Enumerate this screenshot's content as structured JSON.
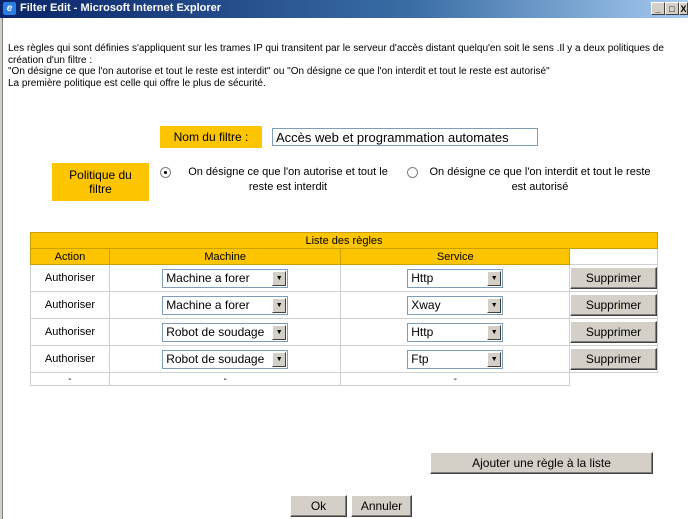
{
  "window": {
    "title": "Filter Edit - Microsoft Internet Explorer",
    "minimize_glyph": "_",
    "maximize_glyph": "□",
    "close_glyph": "X"
  },
  "intro": {
    "line1": "Les règles qui sont définies s'appliquent sur les trames IP qui transitent par le serveur d'accès distant quelqu'en soit le sens .Il y a deux politiques de création d'un filtre :",
    "line2": "\"On désigne ce que l'on autorise et tout le reste est interdit\" ou \"On désigne ce que l'on interdit et tout le reste est autorisé\"",
    "line3": "La première politique est celle qui offre le plus de sécurité."
  },
  "filter_name": {
    "label": "Nom du filtre :",
    "value": "Accès web et programmation automates"
  },
  "policy": {
    "label": "Politique du filtre",
    "option1": "On désigne ce que l'on autorise et tout le reste est interdit",
    "option2": "On désigne ce que l'on interdit et tout le reste est autorisé",
    "selected": 1
  },
  "rules": {
    "caption": "Liste des règles",
    "headers": {
      "action": "Action",
      "machine": "Machine",
      "service": "Service"
    },
    "rows": [
      {
        "action": "Authoriser",
        "machine": "Machine a forer",
        "service": "Http",
        "delete_label": "Supprimer"
      },
      {
        "action": "Authoriser",
        "machine": "Machine a forer",
        "service": "Xway",
        "delete_label": "Supprimer"
      },
      {
        "action": "Authoriser",
        "machine": "Robot de soudage",
        "service": "Http",
        "delete_label": "Supprimer"
      },
      {
        "action": "Authoriser",
        "machine": "Robot de soudage",
        "service": "Ftp",
        "delete_label": "Supprimer"
      }
    ],
    "empty_row": {
      "action": "-",
      "machine": "-",
      "service": "-"
    }
  },
  "buttons": {
    "add_rule": "Ajouter une règle à la liste",
    "ok": "Ok",
    "cancel": "Annuler"
  }
}
